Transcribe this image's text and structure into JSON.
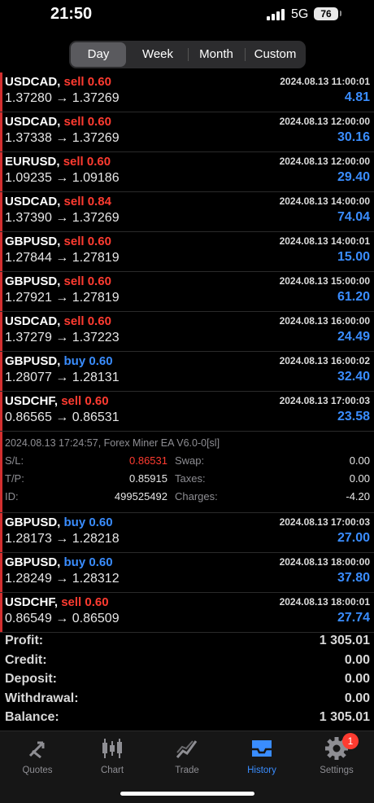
{
  "status_bar": {
    "time": "21:50",
    "network": "5G",
    "battery": "76"
  },
  "period_tabs": {
    "active": "Day",
    "items": [
      "Day",
      "Week",
      "Month",
      "Custom"
    ]
  },
  "trades": [
    {
      "symbol": "USDCAD,",
      "side": "sell",
      "volume": "0.60",
      "datetime": "2024.08.13 11:00:01",
      "price_open": "1.37280",
      "price_close": "1.37269",
      "profit": "4.81"
    },
    {
      "symbol": "USDCAD,",
      "side": "sell",
      "volume": "0.60",
      "datetime": "2024.08.13 12:00:00",
      "price_open": "1.37338",
      "price_close": "1.37269",
      "profit": "30.16"
    },
    {
      "symbol": "EURUSD,",
      "side": "sell",
      "volume": "0.60",
      "datetime": "2024.08.13 12:00:00",
      "price_open": "1.09235",
      "price_close": "1.09186",
      "profit": "29.40"
    },
    {
      "symbol": "USDCAD,",
      "side": "sell",
      "volume": "0.84",
      "datetime": "2024.08.13 14:00:00",
      "price_open": "1.37390",
      "price_close": "1.37269",
      "profit": "74.04"
    },
    {
      "symbol": "GBPUSD,",
      "side": "sell",
      "volume": "0.60",
      "datetime": "2024.08.13 14:00:01",
      "price_open": "1.27844",
      "price_close": "1.27819",
      "profit": "15.00"
    },
    {
      "symbol": "GBPUSD,",
      "side": "sell",
      "volume": "0.60",
      "datetime": "2024.08.13 15:00:00",
      "price_open": "1.27921",
      "price_close": "1.27819",
      "profit": "61.20"
    },
    {
      "symbol": "USDCAD,",
      "side": "sell",
      "volume": "0.60",
      "datetime": "2024.08.13 16:00:00",
      "price_open": "1.37279",
      "price_close": "1.37223",
      "profit": "24.49"
    },
    {
      "symbol": "GBPUSD,",
      "side": "buy",
      "volume": "0.60",
      "datetime": "2024.08.13 16:00:02",
      "price_open": "1.28077",
      "price_close": "1.28131",
      "profit": "32.40"
    },
    {
      "symbol": "USDCHF,",
      "side": "sell",
      "volume": "0.60",
      "datetime": "2024.08.13 17:00:03",
      "price_open": "0.86565",
      "price_close": "0.86531",
      "profit": "23.58"
    },
    {
      "symbol": "GBPUSD,",
      "side": "buy",
      "volume": "0.60",
      "datetime": "2024.08.13 17:00:03",
      "price_open": "1.28173",
      "price_close": "1.28218",
      "profit": "27.00"
    },
    {
      "symbol": "GBPUSD,",
      "side": "buy",
      "volume": "0.60",
      "datetime": "2024.08.13 18:00:00",
      "price_open": "1.28249",
      "price_close": "1.28312",
      "profit": "37.80"
    },
    {
      "symbol": "USDCHF,",
      "side": "sell",
      "volume": "0.60",
      "datetime": "2024.08.13 18:00:01",
      "price_open": "0.86549",
      "price_close": "0.86509",
      "profit": "27.74"
    }
  ],
  "arrow": "→",
  "expanded_detail": {
    "header": "2024.08.13 17:24:57, Forex Miner EA V6.0-0[sl]",
    "sl_label": "S/L:",
    "sl_value": "0.86531",
    "tp_label": "T/P:",
    "tp_value": "0.85915",
    "id_label": "ID:",
    "id_value": "499525492",
    "swap_label": "Swap:",
    "swap_value": "0.00",
    "taxes_label": "Taxes:",
    "taxes_value": "0.00",
    "charges_label": "Charges:",
    "charges_value": "-4.20"
  },
  "summary": [
    {
      "label": "Profit:",
      "value": "1 305.01"
    },
    {
      "label": "Credit:",
      "value": "0.00"
    },
    {
      "label": "Deposit:",
      "value": "0.00"
    },
    {
      "label": "Withdrawal:",
      "value": "0.00"
    },
    {
      "label": "Balance:",
      "value": "1 305.01"
    }
  ],
  "tab_bar": {
    "items": [
      {
        "label": "Quotes",
        "icon": "quotes-arrows-icon"
      },
      {
        "label": "Chart",
        "icon": "candlestick-icon"
      },
      {
        "label": "Trade",
        "icon": "trade-line-icon"
      },
      {
        "label": "History",
        "icon": "inbox-tray-icon"
      },
      {
        "label": "Settings",
        "icon": "gear-icon"
      }
    ],
    "active": "History",
    "settings_badge": "1"
  },
  "colors": {
    "sell": "#ff3b30",
    "buy": "#3a8dff",
    "profit": "#3a8dff",
    "accent_bar": "#d32f2f",
    "sl_value": "#ff3b30"
  }
}
